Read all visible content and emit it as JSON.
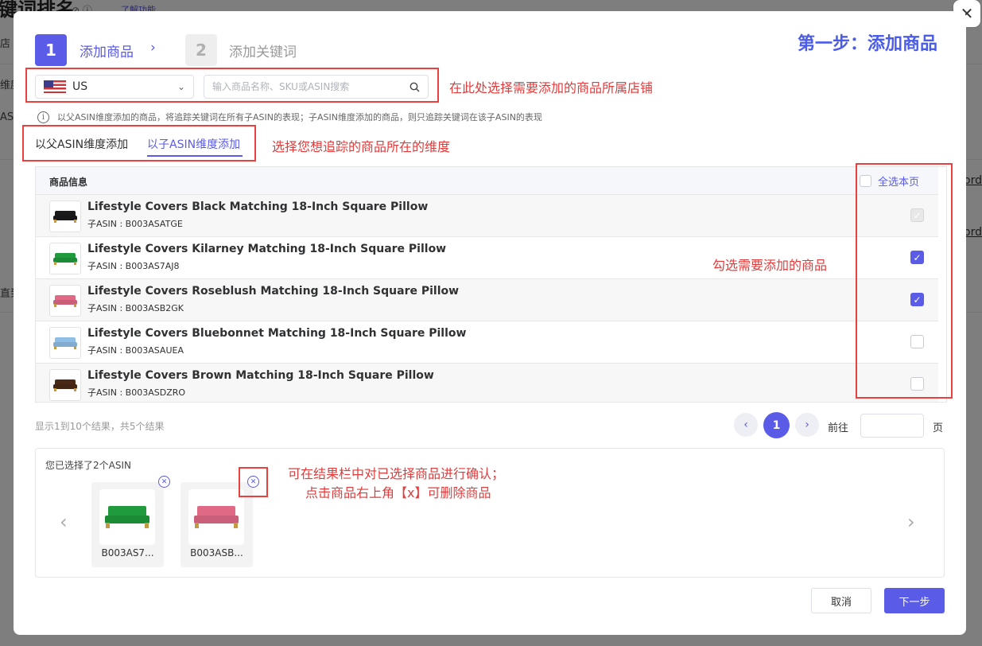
{
  "background": {
    "title": "键词排名",
    "link": "了解功能",
    "side_labels": [
      "店",
      "维度",
      "ASI",
      "直到"
    ],
    "right_labels": [
      "ord",
      "ord"
    ]
  },
  "dialog": {
    "banner": "第一步：添加商品",
    "close": "✕",
    "steps": [
      {
        "num": "1",
        "label": "添加商品"
      },
      {
        "num": "2",
        "label": "添加关键词"
      }
    ],
    "step_arrow": "›",
    "store": {
      "value": "US",
      "arrow": "⌄"
    },
    "search": {
      "placeholder": "输入商品名称、SKU或ASIN搜索",
      "icon": "search-icon"
    },
    "info": {
      "icon": "i",
      "text": "以父ASIN维度添加的商品，将追踪关键词在所有子ASIN的表现；子ASIN维度添加的商品，则只追踪关键词在该子ASIN的表现"
    },
    "tabs": [
      {
        "label": "以父ASIN维度添加",
        "active": false
      },
      {
        "label": "以子ASIN维度添加",
        "active": true
      }
    ],
    "table": {
      "header_info": "商品信息",
      "header_select": "全选本页",
      "rows": [
        {
          "title": "Lifestyle Covers Black Matching 18-Inch Square Pillow",
          "asin": "子ASIN : B003ASATGE",
          "state": "disabled",
          "color": "#1a1a1a"
        },
        {
          "title": "Lifestyle Covers Kilarney Matching 18-Inch Square Pillow",
          "asin": "子ASIN : B003AS7AJ8",
          "state": "checked",
          "color": "#1f9a3c"
        },
        {
          "title": "Lifestyle Covers Roseblush Matching 18-Inch Square Pillow",
          "asin": "子ASIN : B003ASB2GK",
          "state": "checked",
          "color": "#e06a86"
        },
        {
          "title": "Lifestyle Covers Bluebonnet Matching 18-Inch Square Pillow",
          "asin": "子ASIN : B003ASAUEA",
          "state": "unchecked",
          "color": "#8fbfe6"
        },
        {
          "title": "Lifestyle Covers Brown Matching 18-Inch Square Pillow",
          "asin": "子ASIN : B003ASDZRO",
          "state": "unchecked",
          "color": "#4a2a16"
        }
      ]
    },
    "pagination": {
      "summary": "显示1到10个结果，共5个结果",
      "prev": "‹",
      "current": "1",
      "next": "›",
      "goto_label": "前往",
      "goto_value": "",
      "page_unit": "页"
    },
    "selected": {
      "title": "您已选择了2个ASIN",
      "prev": "‹",
      "next": "›",
      "items": [
        {
          "label": "B003AS7...",
          "color": "#1f9a3c"
        },
        {
          "label": "B003ASB...",
          "color": "#e06a86"
        }
      ]
    },
    "buttons": {
      "cancel": "取消",
      "next": "下一步"
    }
  },
  "annotations": {
    "store": "在此处选择需要添加的商品所属店铺",
    "dimension": "选择您想追踪的商品所在的维度",
    "check": "勾选需要添加的商品",
    "confirm_line1": "可在结果栏中对已选择商品进行确认；",
    "confirm_line2": "点击商品右上角【x】可删除商品"
  },
  "colors": {
    "accent": "#5a5be6",
    "annotation": "#e8413f"
  }
}
